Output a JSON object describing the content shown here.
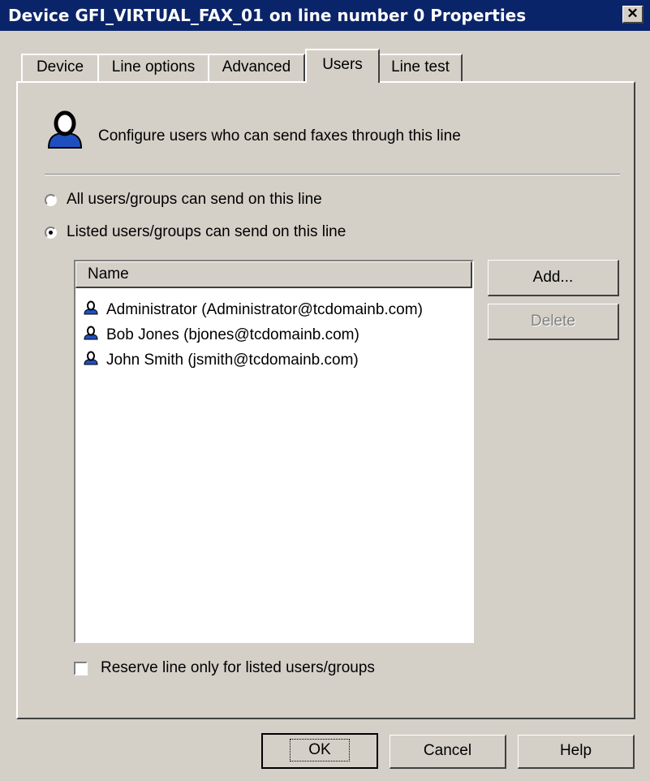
{
  "window": {
    "title": "Device GFI_VIRTUAL_FAX_01 on line number 0 Properties",
    "close_glyph": "✕"
  },
  "tabs": [
    {
      "label": "Device",
      "active": false
    },
    {
      "label": "Line options",
      "active": false
    },
    {
      "label": "Advanced",
      "active": false
    },
    {
      "label": "Users",
      "active": true
    },
    {
      "label": "Line test",
      "active": false
    }
  ],
  "users_page": {
    "header_icon": "user-icon",
    "header_text": "Configure users who can send faxes through this line",
    "radio_all": {
      "label": "All users/groups can send on this line",
      "checked": false
    },
    "radio_listed": {
      "label": "Listed users/groups can send on this line",
      "checked": true
    },
    "list": {
      "column_header": "Name",
      "rows": [
        {
          "icon": "user-icon",
          "text": "Administrator (Administrator@tcdomainb.com)"
        },
        {
          "icon": "user-icon",
          "text": "Bob Jones (bjones@tcdomainb.com)"
        },
        {
          "icon": "user-icon",
          "text": "John Smith (jsmith@tcdomainb.com)"
        }
      ]
    },
    "add_button": "Add...",
    "delete_button": {
      "label": "Delete",
      "enabled": false
    },
    "reserve_checkbox": {
      "label": "Reserve line only for listed users/groups",
      "checked": false
    }
  },
  "footer": {
    "ok": "OK",
    "cancel": "Cancel",
    "help": "Help"
  },
  "colors": {
    "titlebar": "#0a246a",
    "face": "#d4d0c8",
    "user_icon_blue": "#1f4fbf"
  }
}
